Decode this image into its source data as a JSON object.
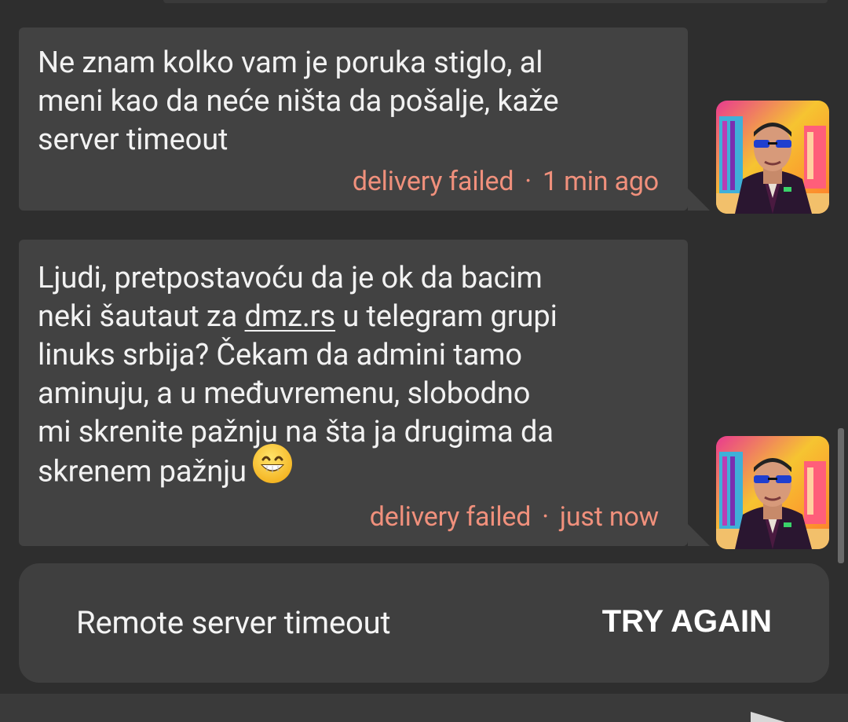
{
  "messages": [
    {
      "text_parts": [
        "Ne znam kolko vam je poruka stiglo, al\nmeni kao da neće ništa da pošalje, kaže\nserver timeout"
      ],
      "status": "delivery failed",
      "separator": "·",
      "time": "1 min ago"
    },
    {
      "text_before_link": "Ljudi, pretpostavoću da je ok da bacim\nneki šautaut za ",
      "link_text": "dmz.rs",
      "text_after_link": " u telegram grupi\nlinuks srbija? Čekam da admini tamo\naminuju, a u međuvremenu, slobodno\nmi skrenite pažnju na šta ja drugima da\nskrenem pažnju",
      "emoji": "grinning-face-with-smiling-eyes",
      "status": "delivery failed",
      "separator": "·",
      "time": "just now"
    }
  ],
  "snackbar": {
    "message": "Remote server timeout",
    "action": "TRY AGAIN"
  },
  "colors": {
    "background": "#2e2e2e",
    "bubble": "#424242",
    "failed_status": "#f0907c",
    "snackbar": "#3f3f3f"
  }
}
